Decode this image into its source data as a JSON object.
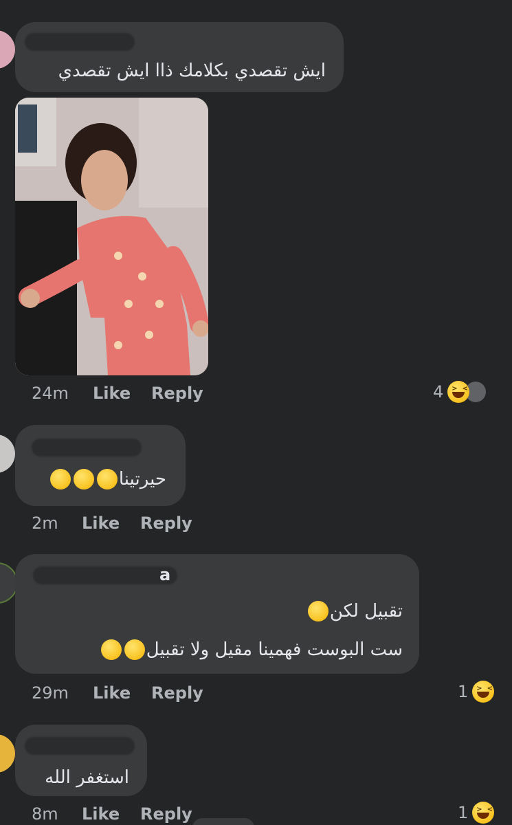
{
  "comments": [
    {
      "text": "ايش تقصدي بكلامك ذاا ايش تقصدي",
      "time": "24m",
      "like": "Like",
      "reply": "Reply",
      "reaction_count": "4"
    },
    {
      "text": "حيرتينا",
      "time": "2m",
      "like": "Like",
      "reply": "Reply"
    },
    {
      "name_fragment": "a",
      "line1": "تقبيل لكن",
      "line2": "ست البوست   فهمينا مقيل ولا تقبيل",
      "time": "29m",
      "like": "Like",
      "reply": "Reply",
      "reaction_count": "1"
    },
    {
      "text": "استغفر الله",
      "time": "8m",
      "like": "Like",
      "reply": "Reply",
      "reaction_count": "1"
    }
  ],
  "colors": {
    "background": "#242526",
    "bubble": "#3a3b3c",
    "text": "#e4e6eb",
    "meta": "#b0b3b8"
  }
}
